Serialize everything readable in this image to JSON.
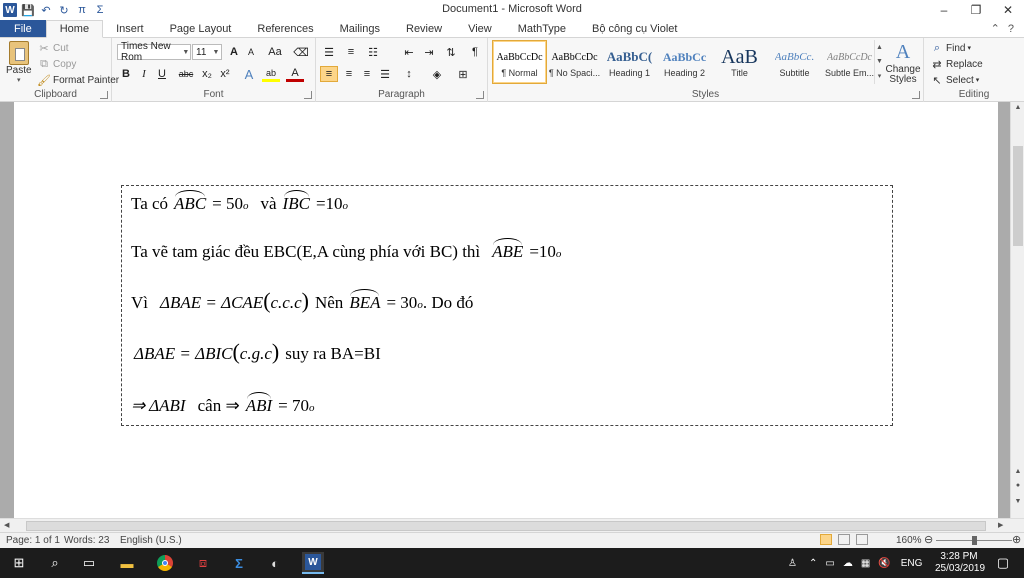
{
  "window": {
    "title": "Document1 - Microsoft Word",
    "minimize": "–",
    "restore": "❐",
    "close": "✕"
  },
  "qat": {
    "save": "💾",
    "undo": "↶",
    "redo": "↻",
    "pi": "π",
    "sigma": "Σ"
  },
  "tabs": [
    "File",
    "Home",
    "Insert",
    "Page Layout",
    "References",
    "Mailings",
    "Review",
    "View",
    "MathType",
    "Bộ công cụ Violet"
  ],
  "ribbon": {
    "clipboard": {
      "label": "Clipboard",
      "paste": "Paste",
      "cut": "Cut",
      "copy": "Copy",
      "format_painter": "Format Painter"
    },
    "font": {
      "label": "Font",
      "name": "Times New Rom",
      "size": "11",
      "bold": "B",
      "italic": "I",
      "underline": "U",
      "strike": "abc",
      "sub": "x₂",
      "sup": "x²",
      "grow": "A",
      "shrink": "A",
      "case": "Aa",
      "text_effects": "A",
      "highlight": "ab",
      "font_color": "A"
    },
    "paragraph": {
      "label": "Paragraph"
    },
    "styles": {
      "label": "Styles",
      "items": [
        {
          "sample": "AaBbCcDc",
          "name": "¶ Normal"
        },
        {
          "sample": "AaBbCcDc",
          "name": "¶ No Spaci..."
        },
        {
          "sample": "AaBbC(",
          "name": "Heading 1"
        },
        {
          "sample": "AaBbCc",
          "name": "Heading 2"
        },
        {
          "sample": "AaB",
          "name": "Title"
        },
        {
          "sample": "AaBbCc.",
          "name": "Subtitle"
        },
        {
          "sample": "AaBbCcDc",
          "name": "Subtle Em..."
        }
      ],
      "change_styles": "Change Styles"
    },
    "editing": {
      "label": "Editing",
      "find": "Find",
      "replace": "Replace",
      "select": "Select"
    }
  },
  "document": {
    "lines": {
      "l1": {
        "a": "Ta có",
        "b": "ABC",
        "c": "= 50",
        "d": "o",
        "e": "và",
        "f": "IBC",
        "g": "=10",
        "h": "o"
      },
      "l2": {
        "a": "Ta vẽ tam giác đều EBC(E,A cùng phía với BC) thì",
        "b": "ABE",
        "c": "=10",
        "d": "o"
      },
      "l3": {
        "a": "Vì",
        "b": "ΔBAE = ΔCAE",
        "c": "c.c.c",
        "d": "Nên",
        "e": "BEA",
        "f": "= 30",
        "g": "o",
        "h": ". Do đó"
      },
      "l4": {
        "a": "ΔBAE = ΔBIC",
        "b": "c.g.c",
        "c": "suy ra BA=BI"
      },
      "l5": {
        "a": "⇒ ΔABI",
        "b": "cân ⇒",
        "c": "ABI",
        "d": "= 70",
        "e": "o"
      }
    }
  },
  "status": {
    "page": "Page: 1 of 1",
    "words": "Words: 23",
    "language": "English (U.S.)",
    "zoom": "160%"
  },
  "taskbar": {
    "time": "3:28 PM",
    "date": "25/03/2019",
    "lang": "ENG"
  }
}
